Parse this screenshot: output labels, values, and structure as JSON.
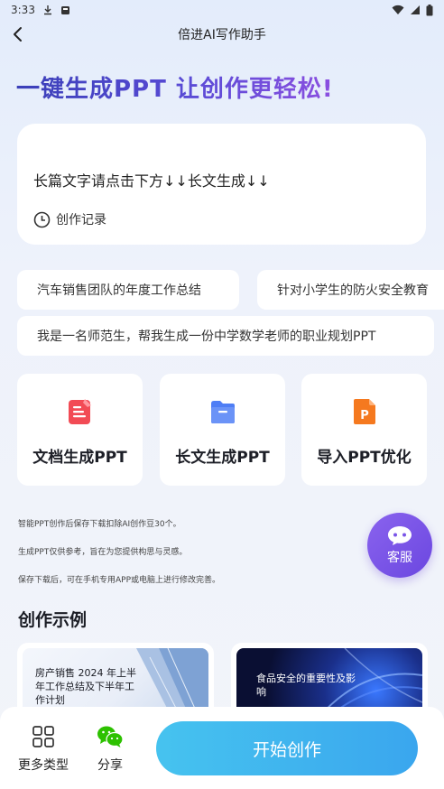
{
  "status": {
    "time": "3:33"
  },
  "nav": {
    "title": "倍进AI写作助手"
  },
  "hero": {
    "title": "一键生成PPT 让创作更轻松!"
  },
  "prompt": {
    "text": "长篇文字请点击下方↓↓长文生成↓↓",
    "history_label": "创作记录"
  },
  "suggestions": [
    "汽车销售团队的年度工作总结",
    "针对小学生的防火安全教育",
    "我是一名师范生，帮我生成一份中学数学老师的职业规划PPT"
  ],
  "features": [
    {
      "label": "文档生成PPT",
      "icon": "document-icon",
      "color": "#f24b55"
    },
    {
      "label": "长文生成PPT",
      "icon": "folder-icon",
      "color": "#4f7ef5"
    },
    {
      "label": "导入PPT优化",
      "icon": "ppt-file-icon",
      "color": "#f5791f"
    }
  ],
  "notices": [
    "智能PPT创作后保存下载扣除AI创作豆30个。",
    "生成PPT仅供参考，旨在为您提供构思与灵感。",
    "保存下载后，可在手机专用APP或电脑上进行修改完善。"
  ],
  "service": {
    "label": "客服"
  },
  "examples": {
    "title": "创作示例",
    "items": [
      {
        "text": "房产销售 2024 年上半年工作总结及下半年工作计划"
      },
      {
        "text": "食品安全的重要性及影响"
      }
    ]
  },
  "bottom": {
    "more_label": "更多类型",
    "share_label": "分享",
    "start_label": "开始创作"
  },
  "colors": {
    "accent": "#3aa6ee",
    "title_gradient_start": "#3a3fb8",
    "title_gradient_end": "#8b4fe0",
    "service": "#7a55e8",
    "wechat": "#2dc100"
  }
}
